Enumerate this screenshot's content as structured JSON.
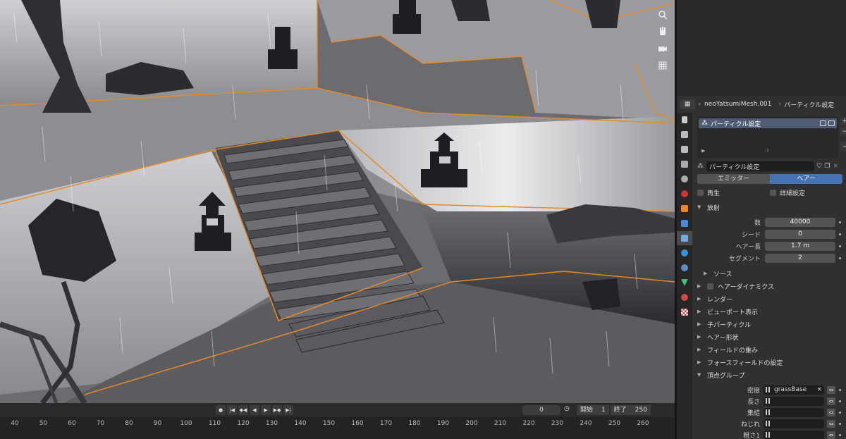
{
  "properties": {
    "header": {
      "object_name": "neoYatsumiMesh.001",
      "particle_settings": "パーティクル設定"
    },
    "slot_name": "パーティクル設定",
    "settings_name": "パーティクル設定",
    "emitter_label": "エミッター",
    "hair_label": "ヘアー",
    "regrow_label": "再生",
    "advanced_label": "詳細設定",
    "emission": {
      "title": "放射",
      "number_label": "数",
      "number_value": "40000",
      "seed_label": "シード",
      "seed_value": "0",
      "hair_length_label": "ヘアー長",
      "hair_length_value": "1.7 m",
      "segments_label": "セグメント",
      "segments_value": "2",
      "source_label": "ソース"
    },
    "sections": [
      "ヘアーダイナミクス",
      "レンダー",
      "ビューポート表示",
      "子パーティクル",
      "ヘアー形状",
      "フィールドの重み",
      "フォースフィールドの設定"
    ],
    "vertex_groups": {
      "title": "頂点グループ",
      "density_label": "密度",
      "density_value": "grassBase",
      "length_label": "長さ",
      "clump_label": "集結",
      "twist_label": "ねじれ",
      "rough1_label": "粗さ1"
    }
  },
  "timeline": {
    "current_frame": "0",
    "start_label": "開始",
    "start_value": "1",
    "end_label": "終了",
    "end_value": "250",
    "ruler": [
      "40",
      "50",
      "60",
      "70",
      "80",
      "90",
      "100",
      "110",
      "120",
      "130",
      "140",
      "150",
      "160",
      "170",
      "180",
      "190",
      "200",
      "210",
      "220",
      "230",
      "240",
      "250",
      "260"
    ]
  },
  "icons": [
    "zoom-icon",
    "hand-icon",
    "camera-icon",
    "grid-icon",
    "wrench-icon",
    "particles-icon",
    "physics-icon",
    "constraints-icon",
    "data-icon",
    "material-icon",
    "texture-icon"
  ]
}
